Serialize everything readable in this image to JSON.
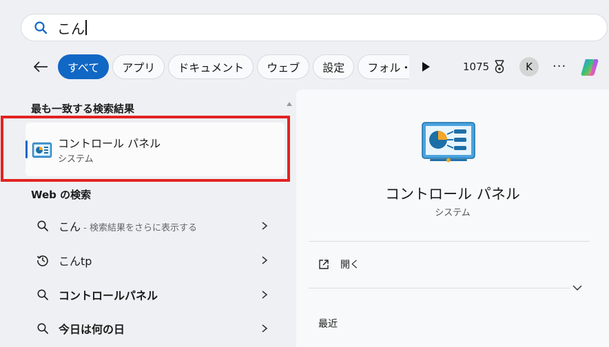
{
  "search": {
    "query": "こん",
    "icon": "search-icon"
  },
  "filters": {
    "tabs": [
      {
        "label": "すべて",
        "active": true
      },
      {
        "label": "アプリ",
        "active": false
      },
      {
        "label": "ドキュメント",
        "active": false
      },
      {
        "label": "ウェブ",
        "active": false
      },
      {
        "label": "設定",
        "active": false
      },
      {
        "label": "フォル・",
        "active": false
      }
    ],
    "points": "1075",
    "avatar_initial": "K",
    "more_label": "···"
  },
  "best_match": {
    "heading": "最も一致する検索結果",
    "title": "コントロール パネル",
    "subtitle": "システム",
    "icon": "control-panel-icon"
  },
  "web": {
    "heading": "Web の検索",
    "items": [
      {
        "label": "こん",
        "hint": " - 検索結果をさらに表示する",
        "icon": "search-icon",
        "bold": false
      },
      {
        "label": "こんtp",
        "hint": "",
        "icon": "history-icon",
        "bold": false
      },
      {
        "label": "コントロールパネル",
        "hint": "",
        "icon": "search-icon",
        "bold": true
      },
      {
        "label": "今日は何の日",
        "hint": "",
        "icon": "search-icon",
        "bold": true
      }
    ]
  },
  "detail": {
    "title": "コントロール パネル",
    "subtitle": "システム",
    "open_label": "開く",
    "recent_heading": "最近"
  },
  "colors": {
    "accent": "#1167c4",
    "highlight_border": "#e32222",
    "background": "#eef0f3"
  }
}
